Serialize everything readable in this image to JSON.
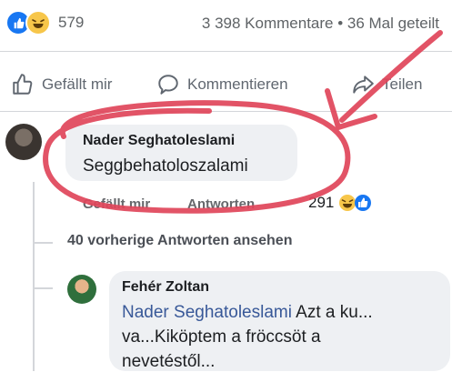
{
  "post_stats": {
    "reaction_icons": [
      "like-icon",
      "haha-icon"
    ],
    "reaction_count": "579",
    "comments_shares": "3 398 Kommentare • 36 Mal geteilt"
  },
  "actions": {
    "like": "Gefällt mir",
    "comment": "Kommentieren",
    "share": "Teilen"
  },
  "comment": {
    "author": "Nader Seghatoleslami",
    "text": "Seggbehatoloszalami",
    "like_label": "Gefällt mir",
    "reply_label": "Antworten",
    "reaction_count": "291"
  },
  "thread": {
    "more_replies": "40 vorherige Antworten ansehen"
  },
  "reply": {
    "author": "Fehér Zoltan",
    "mention": "Nader Seghatoleslami",
    "line1_rest": " Azt a ku...",
    "line2": "va...Kiköptem a fröccsöt a",
    "line3": "nevetéstől..."
  },
  "colors": {
    "facebook_blue": "#1877f2",
    "annotation_red": "#e0455a",
    "bubble_gray": "#eef0f3"
  }
}
